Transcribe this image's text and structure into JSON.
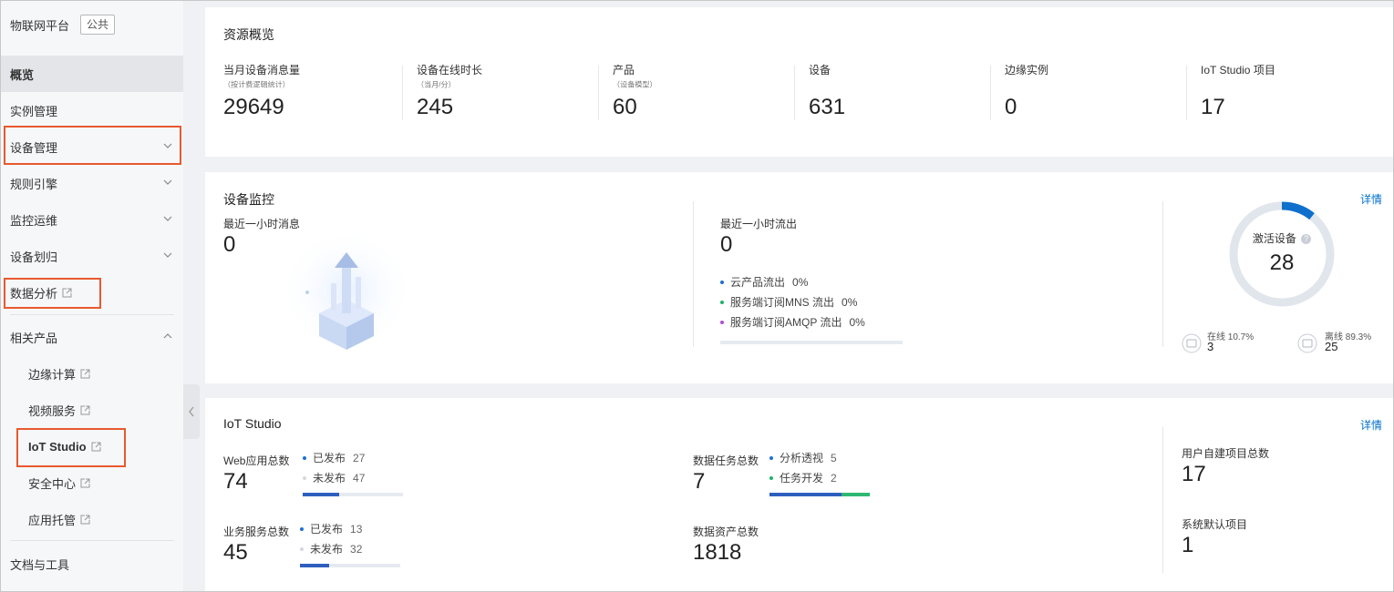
{
  "sidebar": {
    "title": "物联网平台",
    "tag": "公共",
    "items": [
      {
        "label": "概览"
      },
      {
        "label": "实例管理"
      },
      {
        "label": "设备管理"
      },
      {
        "label": "规则引擎"
      },
      {
        "label": "监控运维"
      },
      {
        "label": "设备划归"
      },
      {
        "label": "数据分析"
      },
      {
        "label": "相关产品"
      },
      {
        "label": "边缘计算"
      },
      {
        "label": "视频服务"
      },
      {
        "label": "IoT Studio"
      },
      {
        "label": "安全中心"
      },
      {
        "label": "应用托管"
      },
      {
        "label": "文档与工具"
      }
    ]
  },
  "overview": {
    "title": "资源概览",
    "stats": [
      {
        "label": "当月设备消息量",
        "sub": "（按计费逻辑统计）",
        "value": "29649"
      },
      {
        "label": "设备在线时长",
        "sub": "（当月/分）",
        "value": "245"
      },
      {
        "label": "产品",
        "sub": "（设备模型）",
        "value": "60"
      },
      {
        "label": "设备",
        "sub": "",
        "value": "631"
      },
      {
        "label": "边缘实例",
        "sub": "",
        "value": "0"
      },
      {
        "label": "IoT Studio 项目",
        "sub": "",
        "value": "17"
      }
    ]
  },
  "monitor": {
    "title": "设备监控",
    "detail": "详情",
    "msg_label": "最近一小时消息",
    "msg_value": "0",
    "out_label": "最近一小时流出",
    "out_value": "0",
    "out_items": [
      {
        "label": "云产品流出",
        "pct": "0%",
        "color": "#1f6fd0"
      },
      {
        "label": "服务端订阅MNS 流出",
        "pct": "0%",
        "color": "#1fb36b"
      },
      {
        "label": "服务端订阅AMQP 流出",
        "pct": "0%",
        "color": "#b04fd6"
      }
    ],
    "active_label": "激活设备",
    "active_value": "28",
    "active_fraction": 0.107,
    "online_label": "在线 10.7%",
    "online_value": "3",
    "offline_label": "离线 89.3%",
    "offline_value": "25"
  },
  "studio": {
    "title": "IoT Studio",
    "detail": "详情",
    "web": {
      "label": "Web应用总数",
      "value": "74",
      "published": "已发布",
      "published_n": "27",
      "unpublished": "未发布",
      "unpublished_n": "47",
      "fraction": 0.365
    },
    "service": {
      "label": "业务服务总数",
      "value": "45",
      "published": "已发布",
      "published_n": "13",
      "unpublished": "未发布",
      "unpublished_n": "32",
      "fraction": 0.289
    },
    "task": {
      "label": "数据任务总数",
      "value": "7",
      "a_label": "分析透视",
      "a_n": "5",
      "b_label": "任务开发",
      "b_n": "2",
      "fraction": 0.714
    },
    "asset": {
      "label": "数据资产总数",
      "value": "1818"
    },
    "user_projects": {
      "label": "用户自建项目总数",
      "value": "17"
    },
    "default_projects": {
      "label": "系统默认项目",
      "value": "1"
    }
  }
}
